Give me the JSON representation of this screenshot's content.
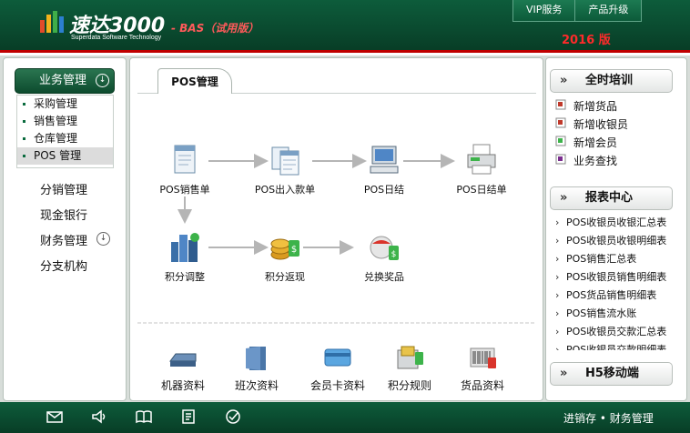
{
  "header": {
    "app_name": "速达3000",
    "app_name_en": "Superdata Software Technology",
    "edition": "- BAS（试用版）",
    "year": "2016 版",
    "buttons": [
      "VIP服务",
      "产品升级"
    ],
    "colors": {
      "primary": "#0a4a2f",
      "accent": "#c00000"
    }
  },
  "sidebar": {
    "header": "业务管理",
    "subitems": [
      "采购管理",
      "销售管理",
      "仓库管理",
      "POS 管理"
    ],
    "active_subitem": "POS 管理",
    "items": [
      "分销管理",
      "现金银行",
      "财务管理",
      "分支机构"
    ]
  },
  "content": {
    "tab": "POS管理",
    "flow": [
      {
        "label": "POS销售单",
        "icon": "document-icon"
      },
      {
        "label": "POS出入款单",
        "icon": "documents-icon"
      },
      {
        "label": "POS日结",
        "icon": "computer-icon"
      },
      {
        "label": "POS日结单",
        "icon": "printer-icon"
      },
      {
        "label": "积分调整",
        "icon": "buildings-icon"
      },
      {
        "label": "积分返现",
        "icon": "coins-icon"
      },
      {
        "label": "兑换奖品",
        "icon": "gift-icon"
      }
    ],
    "bottom": [
      {
        "label": "机器资料",
        "icon": "machine-icon"
      },
      {
        "label": "班次资料",
        "icon": "folder-icon"
      },
      {
        "label": "会员卡资料",
        "icon": "card-icon"
      },
      {
        "label": "积分规则",
        "icon": "card-reader-icon"
      },
      {
        "label": "货品资料",
        "icon": "barcode-icon"
      }
    ]
  },
  "right": {
    "training": {
      "title": "全时培训",
      "items": [
        "新增货品",
        "新增收银员",
        "新增会员",
        "业务查找"
      ]
    },
    "reports": {
      "title": "报表中心",
      "items": [
        "POS收银员收银汇总表",
        "POS收银员收银明细表",
        "POS销售汇总表",
        "POS收银员销售明细表",
        "POS货品销售明细表",
        "POS销售流水账",
        "POS收银员交款汇总表",
        "POS收银员交款明细表"
      ]
    },
    "mobile": {
      "title": "H5移动端"
    }
  },
  "footer": {
    "icons": [
      "mail-icon",
      "speaker-icon",
      "book-icon",
      "notes-icon",
      "check-icon"
    ],
    "right_text": "进销存 • 财务管理"
  }
}
